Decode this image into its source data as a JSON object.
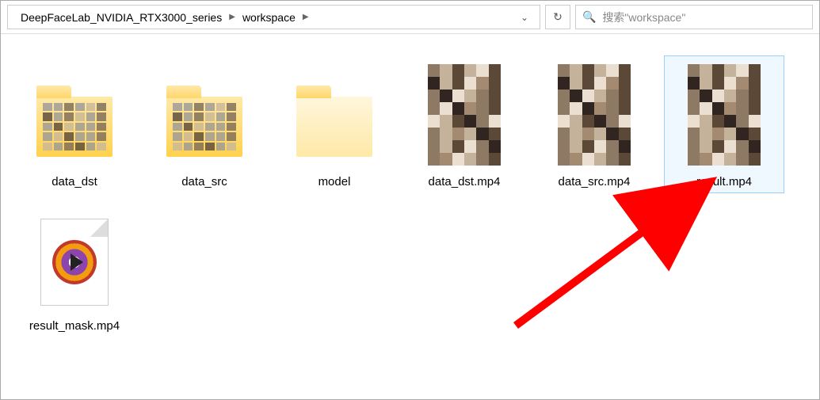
{
  "breadcrumb": {
    "parts": [
      "DeepFaceLab_NVIDIA_RTX3000_series",
      "workspace"
    ]
  },
  "search": {
    "placeholder": "搜索\"workspace\""
  },
  "items": [
    {
      "label": "data_dst",
      "kind": "folder-filled"
    },
    {
      "label": "data_src",
      "kind": "folder-filled"
    },
    {
      "label": "model",
      "kind": "folder-empty"
    },
    {
      "label": "data_dst.mp4",
      "kind": "video-thumb"
    },
    {
      "label": "data_src.mp4",
      "kind": "video-thumb"
    },
    {
      "label": "result.mp4",
      "kind": "video-thumb",
      "selected": true
    },
    {
      "label": "result_mask.mp4",
      "kind": "video-file"
    }
  ],
  "annotation": {
    "arrow_target": "result.mp4"
  }
}
